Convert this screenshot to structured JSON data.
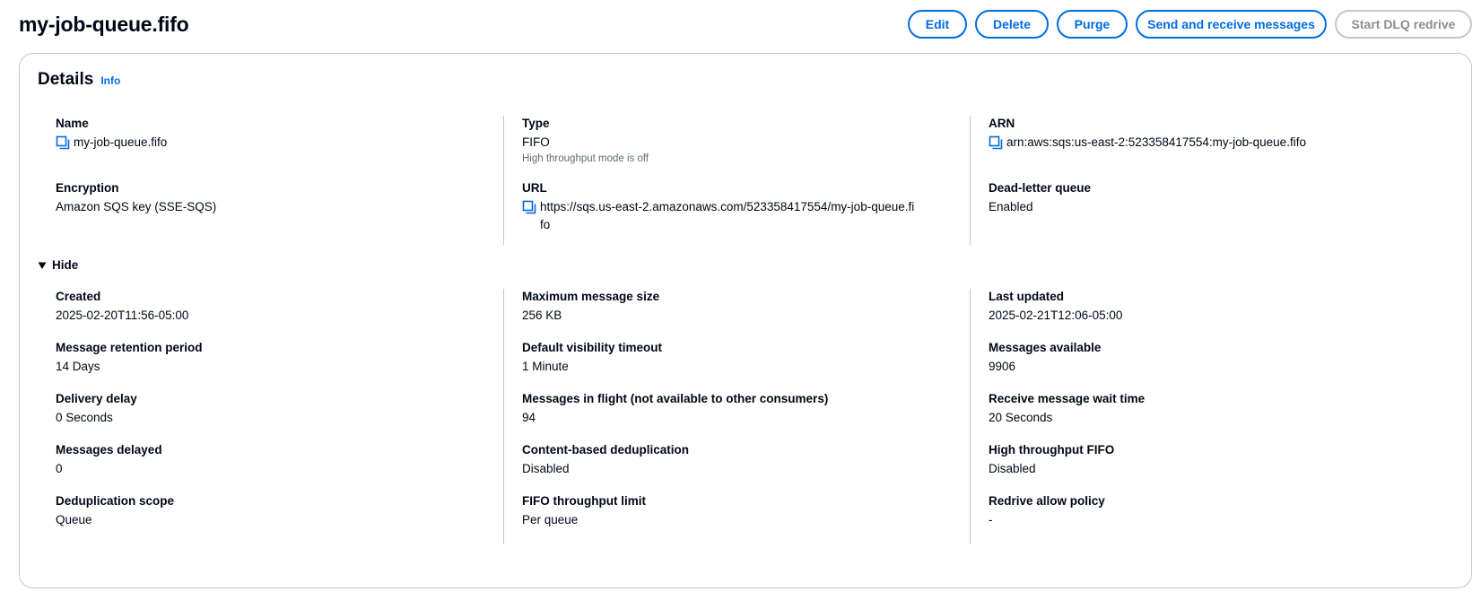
{
  "header": {
    "title": "my-job-queue.fifo",
    "buttons": {
      "edit": "Edit",
      "delete": "Delete",
      "purge": "Purge",
      "send_receive": "Send and receive messages",
      "start_dlq": "Start DLQ redrive"
    }
  },
  "details": {
    "title": "Details",
    "info": "Info",
    "name_label": "Name",
    "name_value": "my-job-queue.fifo",
    "type_label": "Type",
    "type_value": "FIFO",
    "type_sub": "High throughput mode is off",
    "arn_label": "ARN",
    "arn_value": "arn:aws:sqs:us-east-2:523358417554:my-job-queue.fifo",
    "encryption_label": "Encryption",
    "encryption_value": "Amazon SQS key (SSE-SQS)",
    "url_label": "URL",
    "url_value": "https://sqs.us-east-2.amazonaws.com/523358417554/my-job-queue.fifo",
    "dlq_label": "Dead-letter queue",
    "dlq_value": "Enabled",
    "hide_label": "Hide"
  },
  "more": {
    "created_label": "Created",
    "created_value": "2025-02-20T11:56-05:00",
    "max_size_label": "Maximum message size",
    "max_size_value": "256 KB",
    "last_updated_label": "Last updated",
    "last_updated_value": "2025-02-21T12:06-05:00",
    "retention_label": "Message retention period",
    "retention_value": "14 Days",
    "visibility_label": "Default visibility timeout",
    "visibility_value": "1 Minute",
    "available_label": "Messages available",
    "available_value": "9906",
    "delay_label": "Delivery delay",
    "delay_value": "0 Seconds",
    "inflight_label": "Messages in flight (not available to other consumers)",
    "inflight_value": "94",
    "wait_label": "Receive message wait time",
    "wait_value": "20 Seconds",
    "delayed_label": "Messages delayed",
    "delayed_value": "0",
    "content_dedup_label": "Content-based deduplication",
    "content_dedup_value": "Disabled",
    "high_throughput_label": "High throughput FIFO",
    "high_throughput_value": "Disabled",
    "dedup_scope_label": "Deduplication scope",
    "dedup_scope_value": "Queue",
    "fifo_limit_label": "FIFO throughput limit",
    "fifo_limit_value": "Per queue",
    "redrive_label": "Redrive allow policy",
    "redrive_value": "-"
  },
  "colors": {
    "accent": "#006ce0",
    "border": "#c6c6cd",
    "text": "#000716",
    "muted": "#5f6b7a"
  }
}
